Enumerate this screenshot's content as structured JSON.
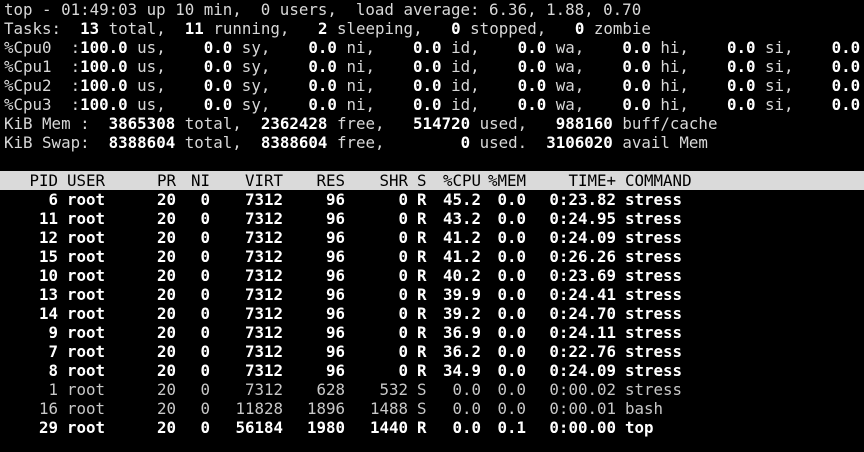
{
  "summary": {
    "top_line": "top - 01:49:03 up 10 min,  0 users,  load average: 6.36, 1.88, 0.70",
    "tasks": {
      "label": "Tasks:",
      "total": "13",
      "total_label": "total,",
      "running": "11",
      "running_label": "running,",
      "sleeping": "2",
      "sleeping_label": "sleeping,",
      "stopped": "0",
      "stopped_label": "stopped,",
      "zombie": "0",
      "zombie_label": "zombie"
    },
    "cpus": [
      {
        "label": "%Cpu0  :",
        "us": "100.0",
        "sy": "0.0",
        "ni": "0.0",
        "id": "0.0",
        "wa": "0.0",
        "hi": "0.0",
        "si": "0.0",
        "st": "0.0"
      },
      {
        "label": "%Cpu1  :",
        "us": "100.0",
        "sy": "0.0",
        "ni": "0.0",
        "id": "0.0",
        "wa": "0.0",
        "hi": "0.0",
        "si": "0.0",
        "st": "0.0"
      },
      {
        "label": "%Cpu2  :",
        "us": "100.0",
        "sy": "0.0",
        "ni": "0.0",
        "id": "0.0",
        "wa": "0.0",
        "hi": "0.0",
        "si": "0.0",
        "st": "0.0"
      },
      {
        "label": "%Cpu3  :",
        "us": "100.0",
        "sy": "0.0",
        "ni": "0.0",
        "id": "0.0",
        "wa": "0.0",
        "hi": "0.0",
        "si": "0.0",
        "st": "0.0"
      }
    ],
    "mem": {
      "label": "KiB Mem :",
      "total": "3865308",
      "total_label": "total,",
      "free": "2362428",
      "free_label": "free,",
      "used": "514720",
      "used_label": "used,",
      "buff": "988160",
      "buff_label": "buff/cache"
    },
    "swap": {
      "label": "KiB Swap:",
      "total": "8388604",
      "total_label": "total,",
      "free": "8388604",
      "free_label": "free,",
      "used": "0",
      "used_label": "used.",
      "avail": "3106020",
      "avail_label": "avail Mem"
    }
  },
  "columns": [
    "PID",
    "USER",
    "PR",
    "NI",
    "VIRT",
    "RES",
    "SHR",
    "S",
    "%CPU",
    "%MEM",
    "TIME+",
    "COMMAND"
  ],
  "processes": [
    {
      "pid": "6",
      "user": "root",
      "pr": "20",
      "ni": "0",
      "virt": "7312",
      "res": "96",
      "shr": "0",
      "s": "R",
      "cpu": "45.2",
      "mem": "0.0",
      "time": "0:23.82",
      "cmd": "stress",
      "style": "bold"
    },
    {
      "pid": "11",
      "user": "root",
      "pr": "20",
      "ni": "0",
      "virt": "7312",
      "res": "96",
      "shr": "0",
      "s": "R",
      "cpu": "43.2",
      "mem": "0.0",
      "time": "0:24.95",
      "cmd": "stress",
      "style": "bold"
    },
    {
      "pid": "12",
      "user": "root",
      "pr": "20",
      "ni": "0",
      "virt": "7312",
      "res": "96",
      "shr": "0",
      "s": "R",
      "cpu": "41.2",
      "mem": "0.0",
      "time": "0:24.09",
      "cmd": "stress",
      "style": "bold"
    },
    {
      "pid": "15",
      "user": "root",
      "pr": "20",
      "ni": "0",
      "virt": "7312",
      "res": "96",
      "shr": "0",
      "s": "R",
      "cpu": "41.2",
      "mem": "0.0",
      "time": "0:26.26",
      "cmd": "stress",
      "style": "bold"
    },
    {
      "pid": "10",
      "user": "root",
      "pr": "20",
      "ni": "0",
      "virt": "7312",
      "res": "96",
      "shr": "0",
      "s": "R",
      "cpu": "40.2",
      "mem": "0.0",
      "time": "0:23.69",
      "cmd": "stress",
      "style": "bold"
    },
    {
      "pid": "13",
      "user": "root",
      "pr": "20",
      "ni": "0",
      "virt": "7312",
      "res": "96",
      "shr": "0",
      "s": "R",
      "cpu": "39.9",
      "mem": "0.0",
      "time": "0:24.41",
      "cmd": "stress",
      "style": "bold"
    },
    {
      "pid": "14",
      "user": "root",
      "pr": "20",
      "ni": "0",
      "virt": "7312",
      "res": "96",
      "shr": "0",
      "s": "R",
      "cpu": "39.2",
      "mem": "0.0",
      "time": "0:24.70",
      "cmd": "stress",
      "style": "bold"
    },
    {
      "pid": "9",
      "user": "root",
      "pr": "20",
      "ni": "0",
      "virt": "7312",
      "res": "96",
      "shr": "0",
      "s": "R",
      "cpu": "36.9",
      "mem": "0.0",
      "time": "0:24.11",
      "cmd": "stress",
      "style": "bold"
    },
    {
      "pid": "7",
      "user": "root",
      "pr": "20",
      "ni": "0",
      "virt": "7312",
      "res": "96",
      "shr": "0",
      "s": "R",
      "cpu": "36.2",
      "mem": "0.0",
      "time": "0:22.76",
      "cmd": "stress",
      "style": "bold"
    },
    {
      "pid": "8",
      "user": "root",
      "pr": "20",
      "ni": "0",
      "virt": "7312",
      "res": "96",
      "shr": "0",
      "s": "R",
      "cpu": "34.9",
      "mem": "0.0",
      "time": "0:24.09",
      "cmd": "stress",
      "style": "bold"
    },
    {
      "pid": "1",
      "user": "root",
      "pr": "20",
      "ni": "0",
      "virt": "7312",
      "res": "628",
      "shr": "532",
      "s": "S",
      "cpu": "0.0",
      "mem": "0.0",
      "time": "0:00.02",
      "cmd": "stress",
      "style": "normal"
    },
    {
      "pid": "16",
      "user": "root",
      "pr": "20",
      "ni": "0",
      "virt": "11828",
      "res": "1896",
      "shr": "1488",
      "s": "S",
      "cpu": "0.0",
      "mem": "0.0",
      "time": "0:00.01",
      "cmd": "bash",
      "style": "normal"
    },
    {
      "pid": "29",
      "user": "root",
      "pr": "20",
      "ni": "0",
      "virt": "56184",
      "res": "1980",
      "shr": "1440",
      "s": "R",
      "cpu": "0.0",
      "mem": "0.1",
      "time": "0:00.00",
      "cmd": "top",
      "style": "bold"
    }
  ],
  "colors": {
    "background": "#000000",
    "text": "#d8d8d8",
    "bold": "#ffffff",
    "header_bar": "#dadada"
  }
}
